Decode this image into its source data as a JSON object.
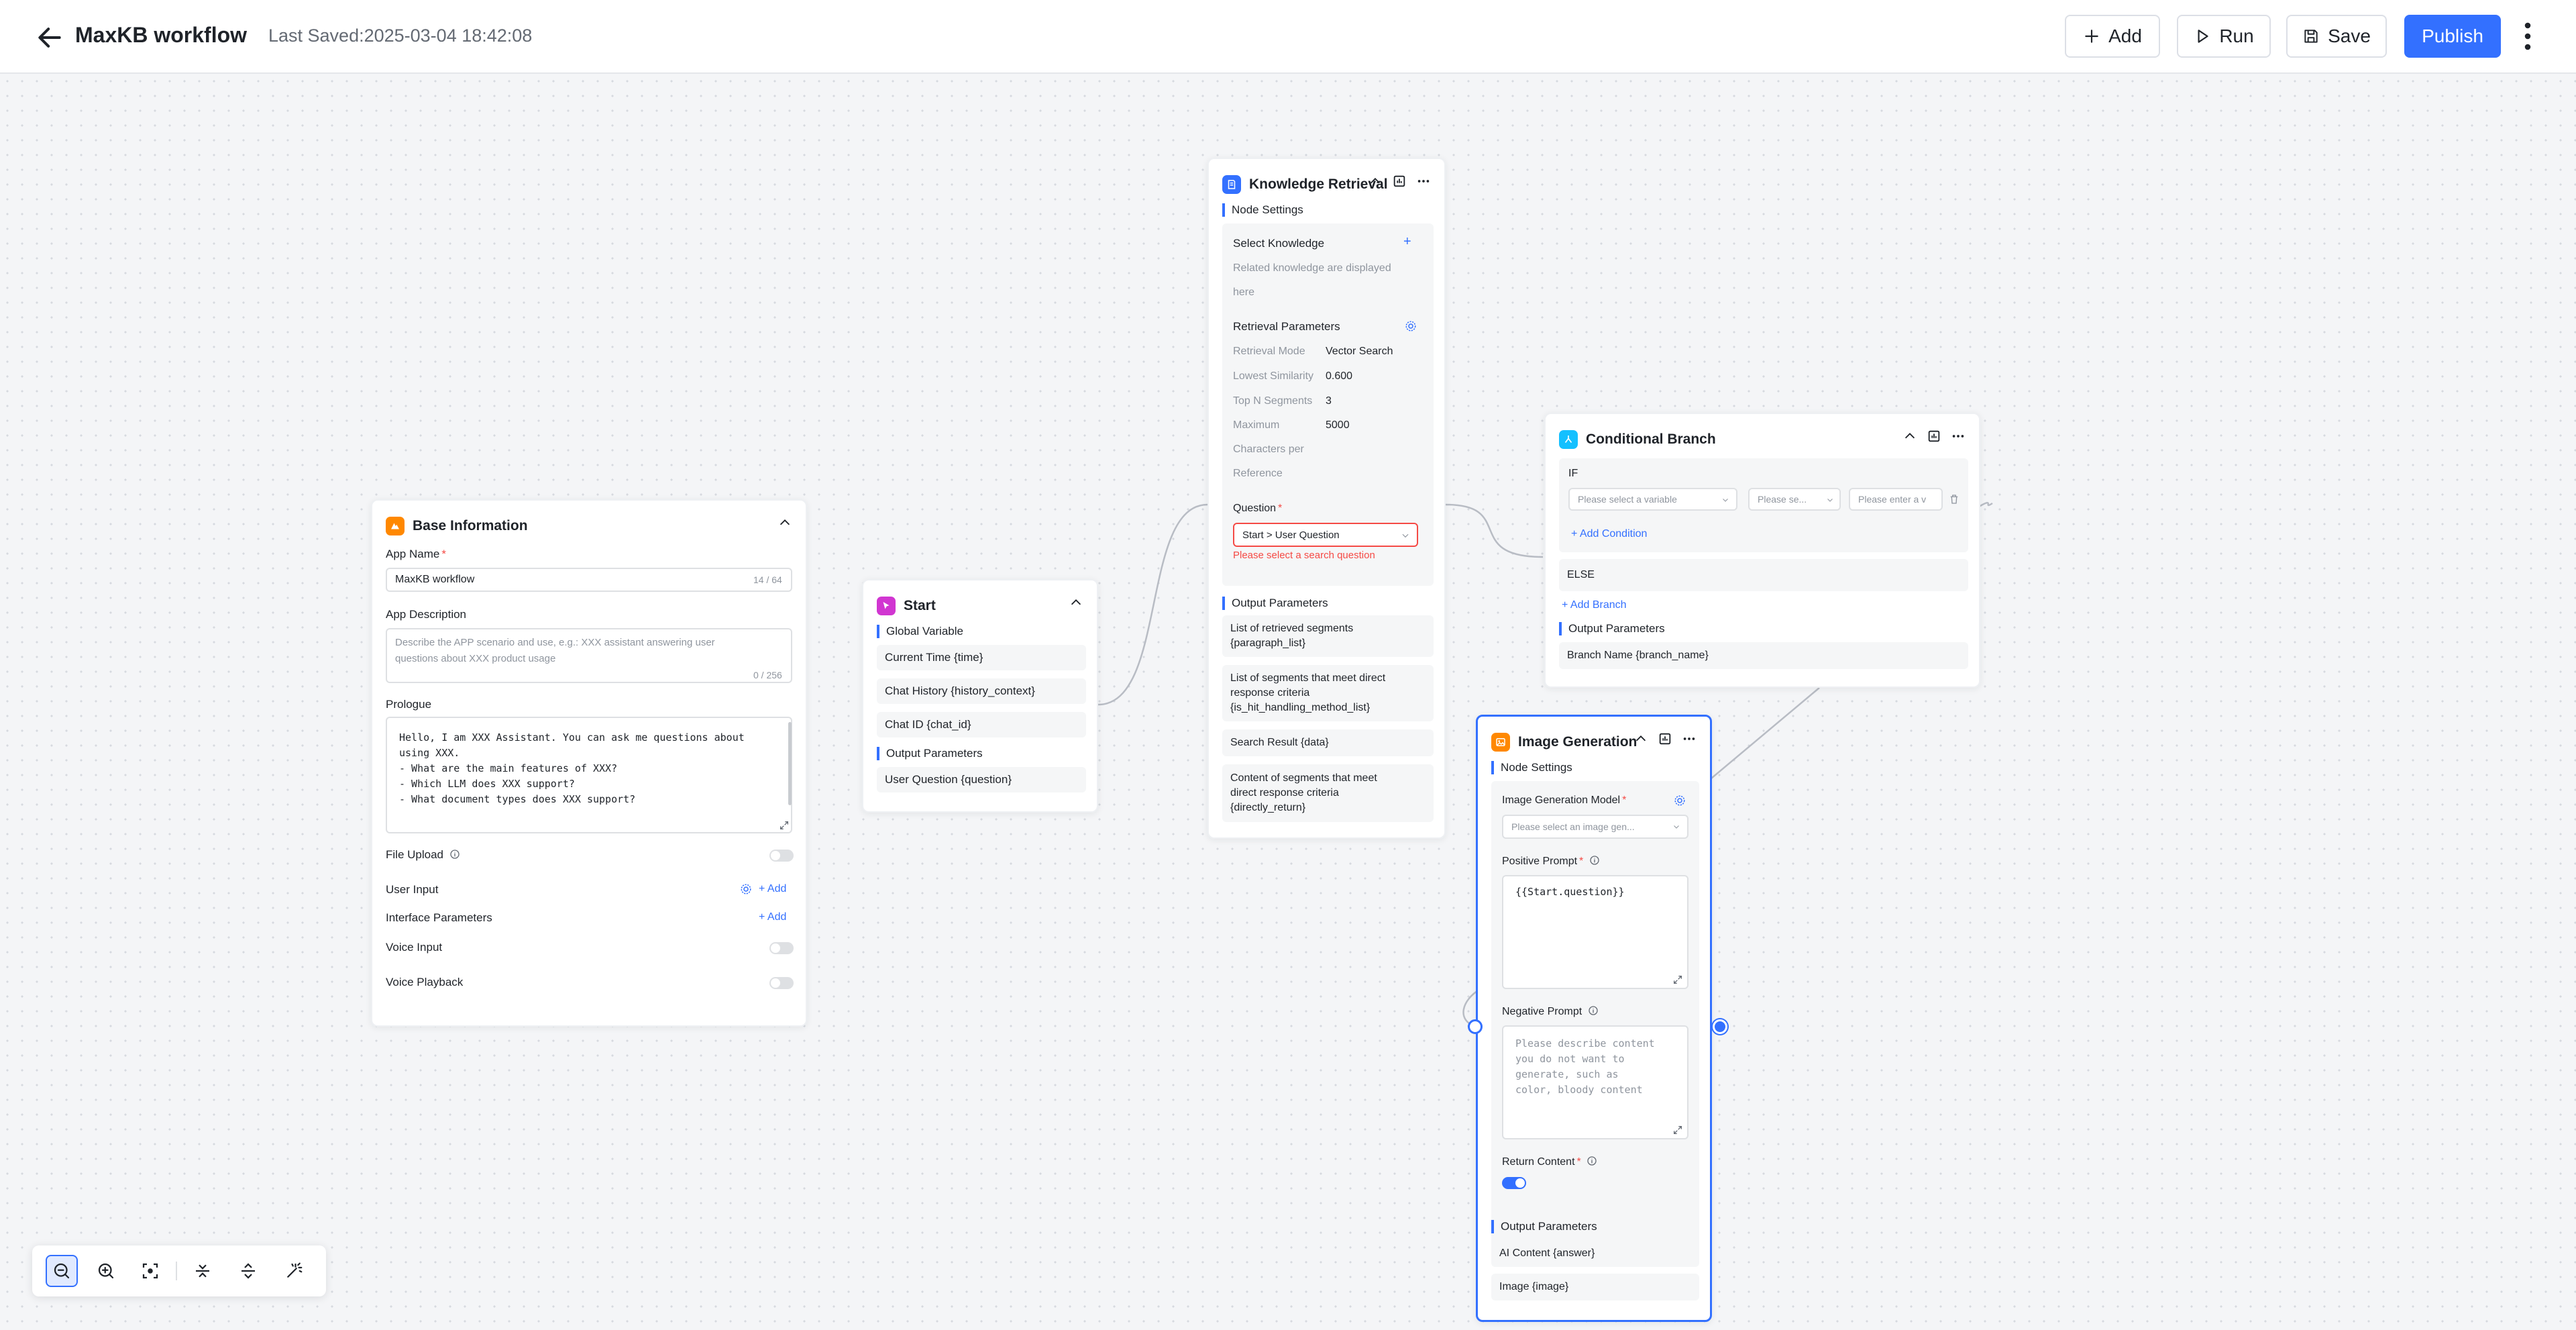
{
  "header": {
    "title": "MaxKB workflow",
    "last_saved_label": "Last Saved:",
    "last_saved_time": "2025-03-04 18:42:08",
    "add_label": "Add",
    "run_label": "Run",
    "save_label": "Save",
    "publish_label": "Publish"
  },
  "base_info": {
    "title": "Base Information",
    "app_name_label": "App Name",
    "app_name_value": "MaxKB workflow",
    "app_name_counter": "14 / 64",
    "app_desc_label": "App Description",
    "app_desc_placeholder": "Describe the APP scenario and use, e.g.: XXX assistant answering user questions about XXX product usage",
    "app_desc_counter": "0 / 256",
    "prologue_label": "Prologue",
    "prologue_lines": [
      "Hello, I am XXX Assistant. You can ask me questions about",
      "using XXX.",
      "- What are the main features of XXX?",
      "- Which LLM does XXX support?",
      "- What document types does XXX support?"
    ],
    "file_upload_label": "File Upload",
    "user_input_label": "User Input",
    "user_input_add": "Add",
    "interface_params_label": "Interface Parameters",
    "interface_params_add": "Add",
    "voice_input_label": "Voice Input",
    "voice_playback_label": "Voice Playback"
  },
  "start": {
    "title": "Start",
    "global_variable": "Global Variable",
    "globals": [
      "Current Time {time}",
      "Chat History {history_context}",
      "Chat ID {chat_id}"
    ],
    "output_parameters": "Output Parameters",
    "outputs": [
      "User Question {question}"
    ]
  },
  "knowledge": {
    "title": "Knowledge Retrieval",
    "node_settings": "Node Settings",
    "select_knowledge": "Select Knowledge",
    "knowledge_hint": [
      "Related knowledge are displayed",
      "here"
    ],
    "retrieval_params": "Retrieval Parameters",
    "params": [
      {
        "k": "Retrieval Mode",
        "v": "Vector Search"
      },
      {
        "k": "Lowest Similarity",
        "v": "0.600"
      },
      {
        "k": "Top N Segments",
        "v": "3"
      },
      {
        "k": "Maximum",
        "v": "5000"
      },
      {
        "k": "Characters per",
        "v": ""
      },
      {
        "k": "Reference",
        "v": ""
      }
    ],
    "question_label": "Question",
    "question_value": "Start > User Question",
    "question_error": "Please select a search question",
    "output_parameters": "Output Parameters",
    "outputs": [
      [
        "List of retrieved segments",
        "{paragraph_list}"
      ],
      [
        "List of segments that meet direct",
        "response criteria",
        "{is_hit_handling_method_list}"
      ],
      [
        "Search Result {data}"
      ],
      [
        "Content of segments that meet",
        "direct response criteria",
        "{directly_return}"
      ]
    ]
  },
  "branch": {
    "title": "Conditional Branch",
    "if_label": "IF",
    "variable_placeholder": "Please select a variable",
    "operator_placeholder": "Please se...",
    "value_placeholder": "Please enter a v",
    "add_condition": "+ Add Condition",
    "else_label": "ELSE",
    "add_branch": "+ Add Branch",
    "output_parameters": "Output Parameters",
    "outputs": [
      "Branch Name {branch_name}"
    ]
  },
  "image_gen": {
    "title": "Image Generation",
    "node_settings": "Node Settings",
    "model_label": "Image Generation Model",
    "model_placeholder": "Please select an image gen...",
    "positive_label": "Positive Prompt",
    "positive_value": "{{Start.question}}",
    "negative_label": "Negative Prompt",
    "negative_placeholder_lines": [
      "Please describe content",
      "you do not want to",
      "generate, such as",
      "color, bloody content"
    ],
    "return_label": "Return Content",
    "output_parameters": "Output Parameters",
    "outputs": [
      "AI Content {answer}",
      "Image {image}"
    ]
  },
  "colors": {
    "accent": "#3370ff",
    "error": "#f54a45",
    "base_icon": "#ff8800",
    "start_icon": "#d136d1",
    "knowledge_icon": "#3370ff",
    "branch_icon": "#14c0ff",
    "image_icon": "#ff8800"
  }
}
